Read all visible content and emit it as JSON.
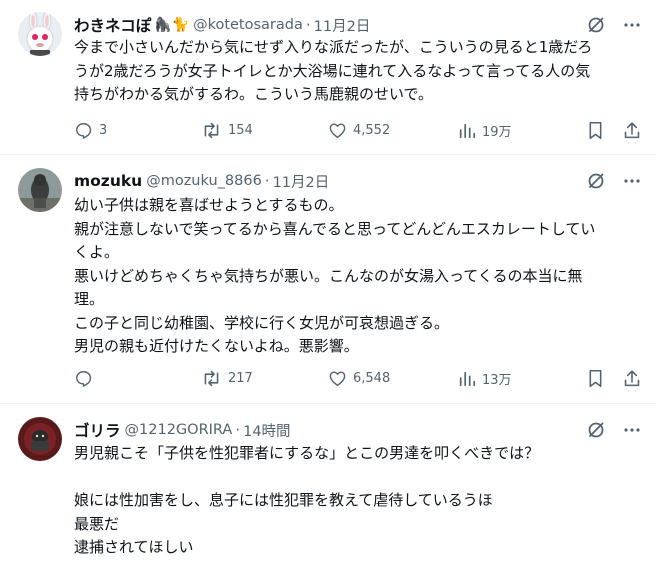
{
  "tweets": [
    {
      "display_name": "わきネコぽ",
      "emoji": "🦍🐈",
      "handle": "@kotetosarada",
      "separator": "·",
      "time": "11月2日",
      "lines": [
        "今まで小さいんだから気にせず入りな派だったが、こういうの見ると1歳だろ",
        "うが2歳だろうが女子トイレとか大浴場に連れて入るなよって言ってる人の気",
        "持ちがわかる気がするわ。こういう馬鹿親のせいで。"
      ],
      "stats": {
        "replies": "3",
        "reposts": "154",
        "likes": "4,552",
        "views": "19万"
      }
    },
    {
      "display_name": "mozuku",
      "emoji": "",
      "handle": "@mozuku_8866",
      "separator": "·",
      "time": "11月2日",
      "lines": [
        "幼い子供は親を喜ばせようとするもの。",
        "親が注意しないで笑ってるから喜んでると思ってどんどんエスカレートしてい",
        "くよ。",
        "悪いけどめちゃくちゃ気持ちが悪い。こんなのが女湯入ってくるの本当に無",
        "理。",
        "この子と同じ幼稚園、学校に行く女児が可哀想過ぎる。",
        "男児の親も近付けたくないよね。悪影響。"
      ],
      "stats": {
        "replies": "",
        "reposts": "217",
        "likes": "6,548",
        "views": "13万"
      }
    },
    {
      "display_name": "ゴリラ",
      "emoji": "",
      "handle": "@1212GORIRA",
      "separator": "·",
      "time": "14時間",
      "lines": [
        "男児親こそ「子供を性犯罪者にするな」とこの男達を叩くべきでは？",
        "",
        "娘には性加害をし、息子には性犯罪を教えて虐待しているうほ",
        "最悪だ",
        "逮捕されてほしい"
      ],
      "stats": null
    }
  ]
}
